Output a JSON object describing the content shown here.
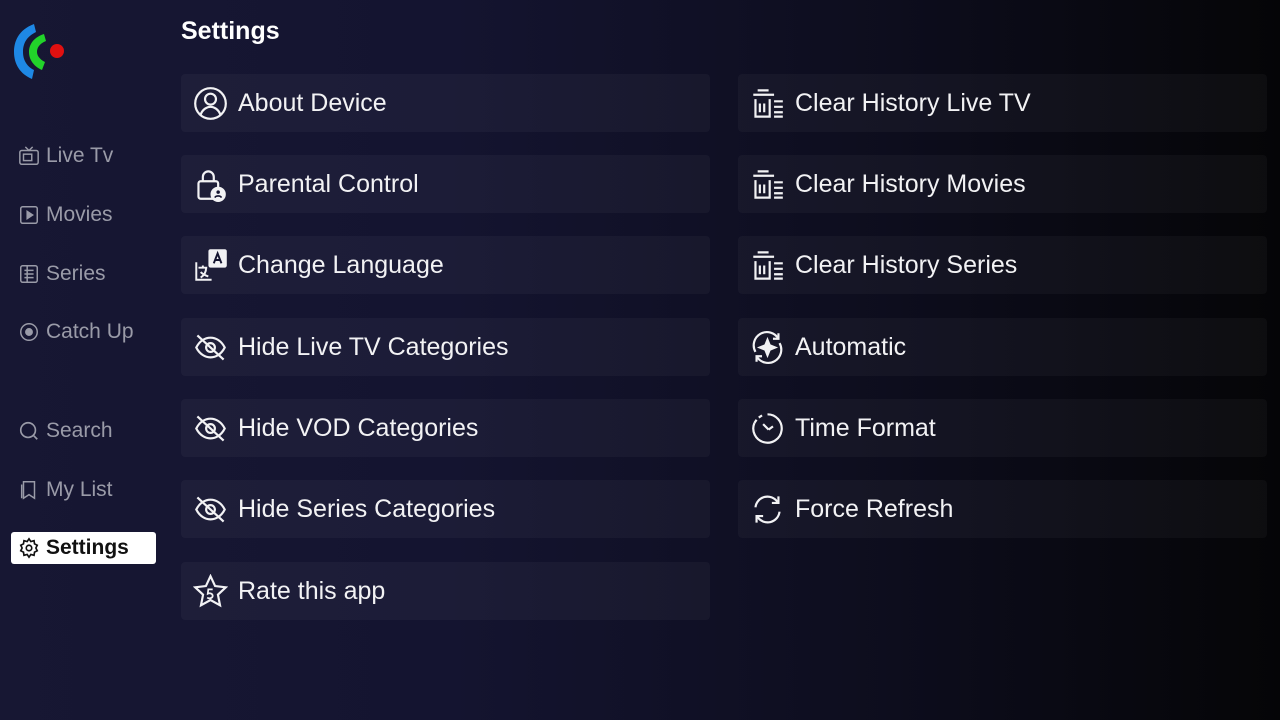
{
  "app": {
    "logo": "app-logo"
  },
  "sidebar": {
    "items": [
      {
        "label": "Live Tv",
        "icon": "tv-icon"
      },
      {
        "label": "Movies",
        "icon": "play-icon"
      },
      {
        "label": "Series",
        "icon": "series-icon"
      },
      {
        "label": "Catch Up",
        "icon": "catchup-icon"
      },
      {
        "label": "Search",
        "icon": "search-icon"
      },
      {
        "label": "My List",
        "icon": "bookmark-icon"
      },
      {
        "label": "Settings",
        "icon": "gear-icon",
        "active": true
      }
    ]
  },
  "page": {
    "title": "Settings"
  },
  "settings": {
    "left": [
      {
        "label": "About Device",
        "icon": "user-circle-icon"
      },
      {
        "label": "Parental Control",
        "icon": "lock-icon"
      },
      {
        "label": "Change Language",
        "icon": "language-icon"
      },
      {
        "label": "Hide Live TV Categories",
        "icon": "eye-off-icon"
      },
      {
        "label": "Hide VOD Categories",
        "icon": "eye-off-icon"
      },
      {
        "label": "Hide Series Categories",
        "icon": "eye-off-icon"
      },
      {
        "label": "Rate this app",
        "icon": "star-icon"
      }
    ],
    "right": [
      {
        "label": "Clear History Live TV",
        "icon": "clear-history-icon"
      },
      {
        "label": "Clear History Movies",
        "icon": "clear-history-icon"
      },
      {
        "label": "Clear History Series",
        "icon": "clear-history-icon"
      },
      {
        "label": "Automatic",
        "icon": "auto-icon"
      },
      {
        "label": "Time Format",
        "icon": "time-icon"
      },
      {
        "label": "Force Refresh",
        "icon": "refresh-icon"
      }
    ]
  },
  "colors": {
    "background": "#141430",
    "active_bg": "#ffffff",
    "muted_text": "#9a9ba8",
    "logo_blue": "#1e88e5",
    "logo_green": "#22d32a",
    "logo_red": "#e01010"
  }
}
